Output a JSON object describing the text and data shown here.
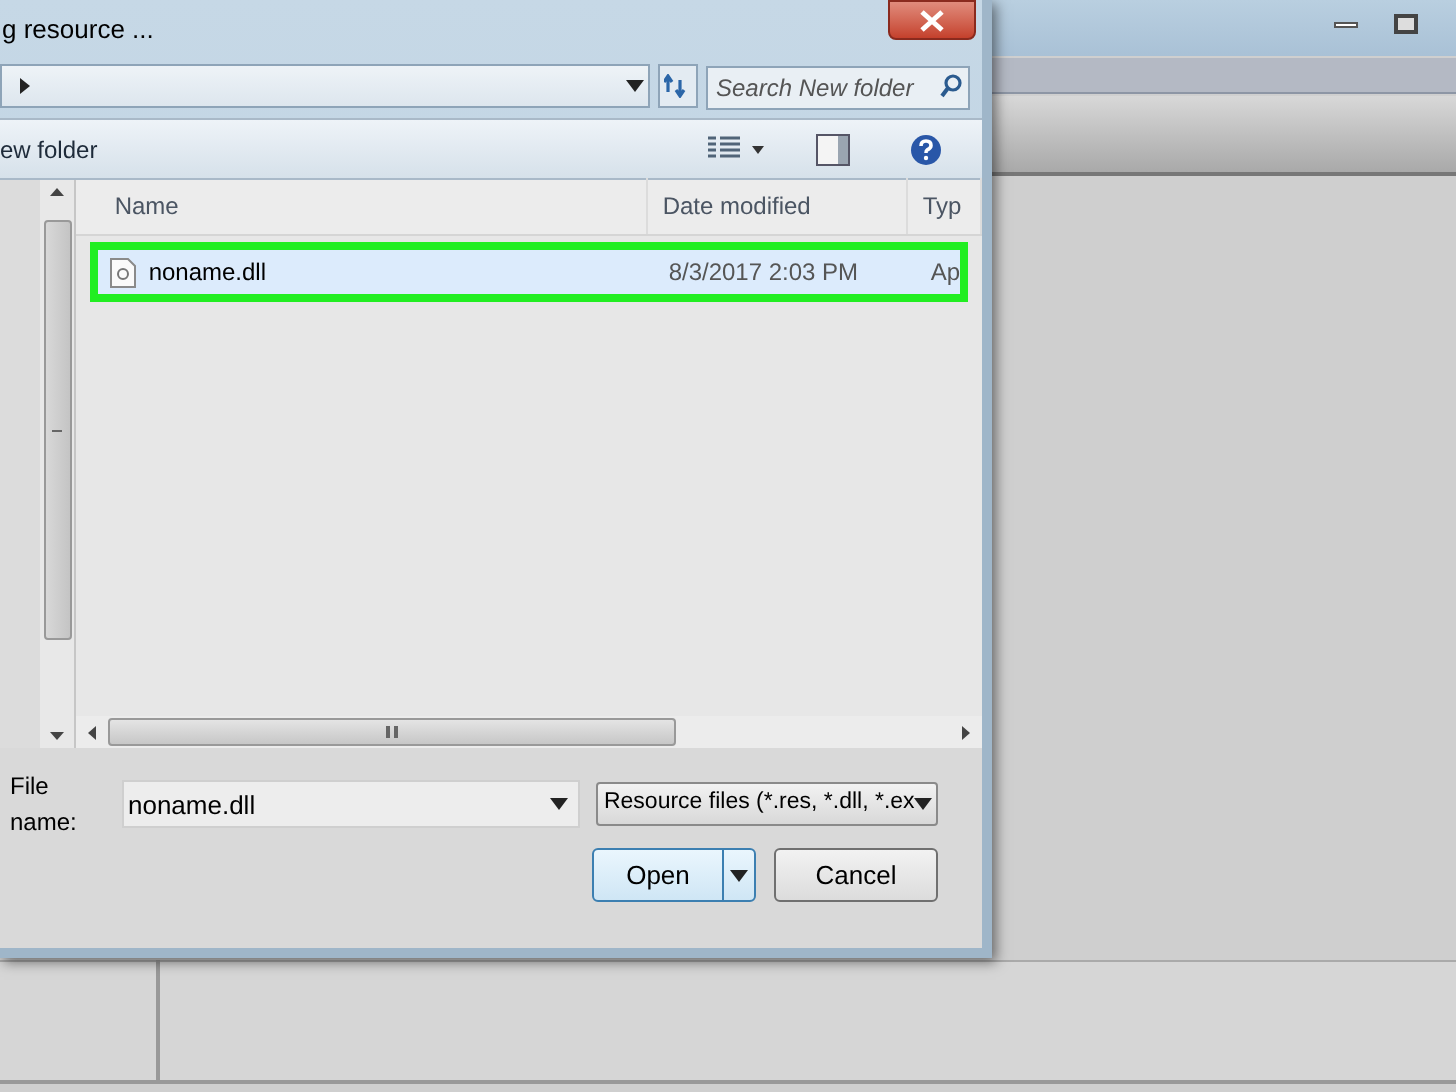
{
  "dialog": {
    "title": "g resource ...",
    "search": {
      "placeholder": "Search New folder"
    },
    "toolbar": {
      "new_folder": "ew folder"
    },
    "columns": [
      "Name",
      "Date modified",
      "Typ"
    ],
    "files": [
      {
        "name": "noname.dll",
        "date": "8/3/2017 2:03 PM",
        "type": "Ap",
        "selected": true
      }
    ],
    "file_name": {
      "label": "File name:",
      "value": "noname.dll"
    },
    "file_type": "Resource files (*.res, *.dll, *.ex",
    "buttons": [
      {
        "label": "Open",
        "kind": "split"
      },
      {
        "label": "Cancel",
        "kind": "plain"
      }
    ]
  }
}
